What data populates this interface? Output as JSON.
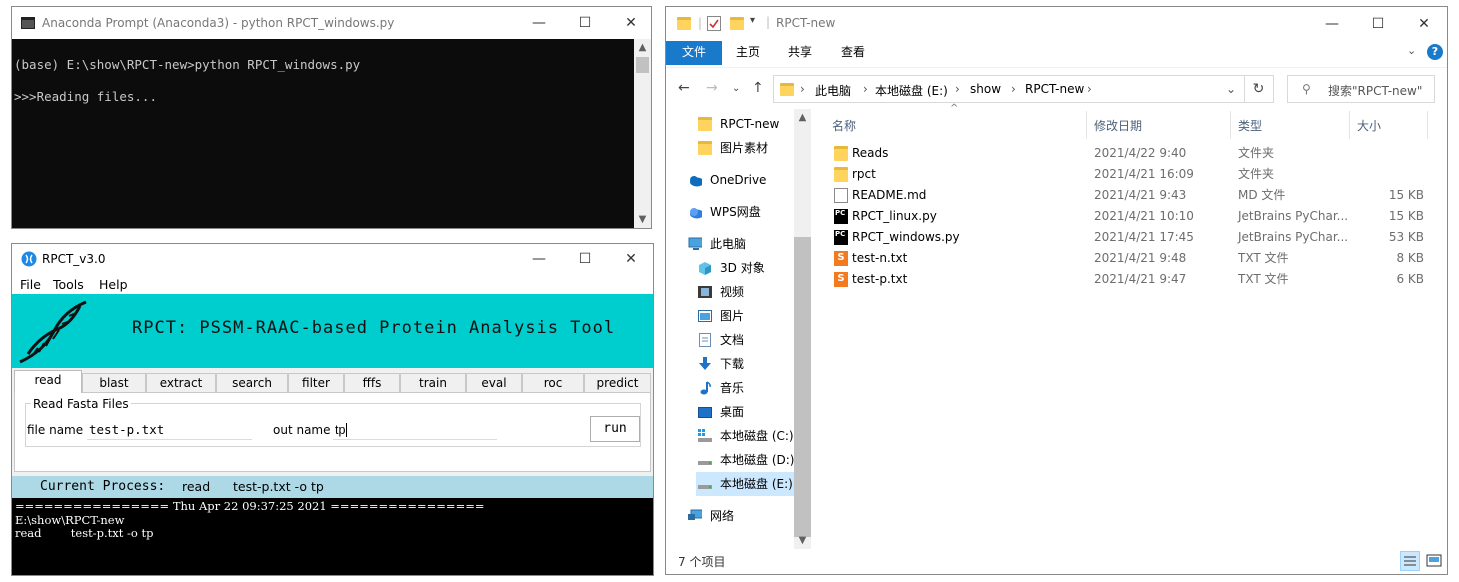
{
  "console": {
    "title": "Anaconda Prompt (Anaconda3) - python  RPCT_windows.py",
    "line1": "(base) E:\\show\\RPCT-new>python RPCT_windows.py",
    "line2": ">>>Reading files..."
  },
  "rpct": {
    "title": "RPCT_v3.0",
    "menu": [
      "File",
      "Tools",
      "Help"
    ],
    "banner_title": "RPCT: PSSM-RAAC-based Protein Analysis Tool",
    "tabs": [
      "read",
      "blast",
      "extract",
      "search",
      "filter",
      "fffs",
      "train",
      "eval",
      "roc",
      "predict"
    ],
    "active_tab": "read",
    "group_label": "Read Fasta Files",
    "file_name_label": "file name",
    "file_name_value": "test-p.txt",
    "out_name_label": "out name",
    "out_name_value": "tp",
    "run_label": "run",
    "status_label": "Current Process:",
    "status_process": "read",
    "status_args": "test-p.txt -o tp",
    "log": [
      "================ Thu Apr 22 09:37:25 2021 ================",
      "E:\\show\\RPCT-new",
      "read        test-p.txt -o tp"
    ]
  },
  "explorer": {
    "title": "RPCT-new",
    "ribbon_tabs": [
      "文件",
      "主页",
      "共享",
      "查看"
    ],
    "path": [
      "此电脑",
      "本地磁盘 (E:)",
      "show",
      "RPCT-new"
    ],
    "search_placeholder": "搜索\"RPCT-new\"",
    "nav_items": [
      {
        "label": "RPCT-new",
        "icon": "folder-icon"
      },
      {
        "label": "图片素材",
        "icon": "folder-icon"
      },
      {
        "label": "OneDrive",
        "icon": "cloud-icon"
      },
      {
        "label": "WPS网盘",
        "icon": "cloud-icon"
      },
      {
        "label": "此电脑",
        "icon": "computer-icon"
      },
      {
        "label": "3D 对象",
        "icon": "cube-icon"
      },
      {
        "label": "视频",
        "icon": "video-icon"
      },
      {
        "label": "图片",
        "icon": "picture-icon"
      },
      {
        "label": "文档",
        "icon": "document-icon"
      },
      {
        "label": "下载",
        "icon": "download-icon"
      },
      {
        "label": "音乐",
        "icon": "music-icon"
      },
      {
        "label": "桌面",
        "icon": "desktop-icon"
      },
      {
        "label": "本地磁盘 (C:)",
        "icon": "drive-icon"
      },
      {
        "label": "本地磁盘 (D:)",
        "icon": "drive-icon"
      },
      {
        "label": "本地磁盘 (E:)",
        "icon": "drive-icon"
      },
      {
        "label": "网络",
        "icon": "network-icon"
      }
    ],
    "selected_nav": "本地磁盘 (E:)",
    "columns": [
      "名称",
      "修改日期",
      "类型",
      "大小"
    ],
    "files": [
      {
        "name": "Reads",
        "date": "2021/4/22 9:40",
        "type": "文件夹",
        "size": "",
        "icon": "folder-icon"
      },
      {
        "name": "rpct",
        "date": "2021/4/21 16:09",
        "type": "文件夹",
        "size": "",
        "icon": "folder-icon"
      },
      {
        "name": "README.md",
        "date": "2021/4/21 9:43",
        "type": "MD 文件",
        "size": "15 KB",
        "icon": "markdown-file-icon"
      },
      {
        "name": "RPCT_linux.py",
        "date": "2021/4/21 10:10",
        "type": "JetBrains PyChar...",
        "size": "15 KB",
        "icon": "pycharm-file-icon"
      },
      {
        "name": "RPCT_windows.py",
        "date": "2021/4/21 17:45",
        "type": "JetBrains PyChar...",
        "size": "53 KB",
        "icon": "pycharm-file-icon"
      },
      {
        "name": "test-n.txt",
        "date": "2021/4/21 9:48",
        "type": "TXT 文件",
        "size": "8 KB",
        "icon": "sublime-text-file-icon"
      },
      {
        "name": "test-p.txt",
        "date": "2021/4/21 9:47",
        "type": "TXT 文件",
        "size": "6 KB",
        "icon": "sublime-text-file-icon"
      }
    ],
    "item_count": "7 个项目"
  },
  "colors": {
    "banner": "#00cdcd",
    "status_bar": "#add8e6",
    "ribbon_file": "#1979ca",
    "nav_selected": "#cce8ff"
  }
}
